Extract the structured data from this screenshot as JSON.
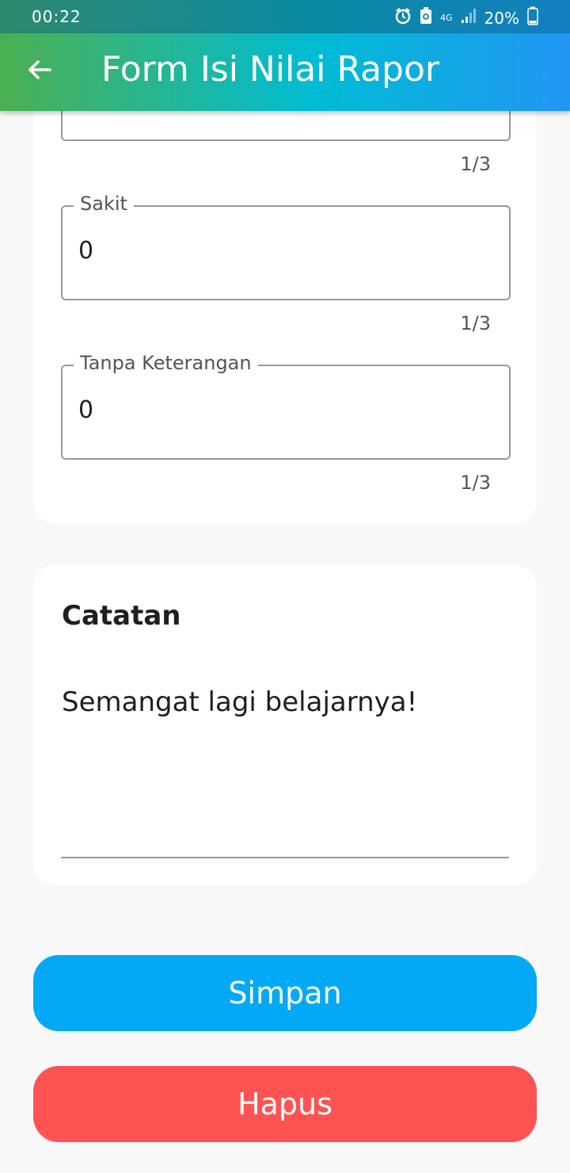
{
  "status_bar": {
    "time": "00:22",
    "network": "4G",
    "battery": "20%"
  },
  "app_bar": {
    "title": "Form Isi Nilai Rapor",
    "back_icon": "arrow-left-icon"
  },
  "attendance": {
    "partial_field": {
      "value": "",
      "counter": "1/3"
    },
    "fields": [
      {
        "label": "Sakit",
        "value": "0",
        "counter": "1/3"
      },
      {
        "label": "Tanpa Keterangan",
        "value": "0",
        "counter": "1/3"
      }
    ]
  },
  "note": {
    "heading": "Catatan",
    "text": "Semangat lagi belajarnya!"
  },
  "buttons": {
    "save": "Simpan",
    "delete": "Hapus"
  },
  "colors": {
    "save": "#03a9f4",
    "delete": "#ff5252",
    "app_bar_start": "#4caf50",
    "app_bar_end": "#2196f3"
  }
}
